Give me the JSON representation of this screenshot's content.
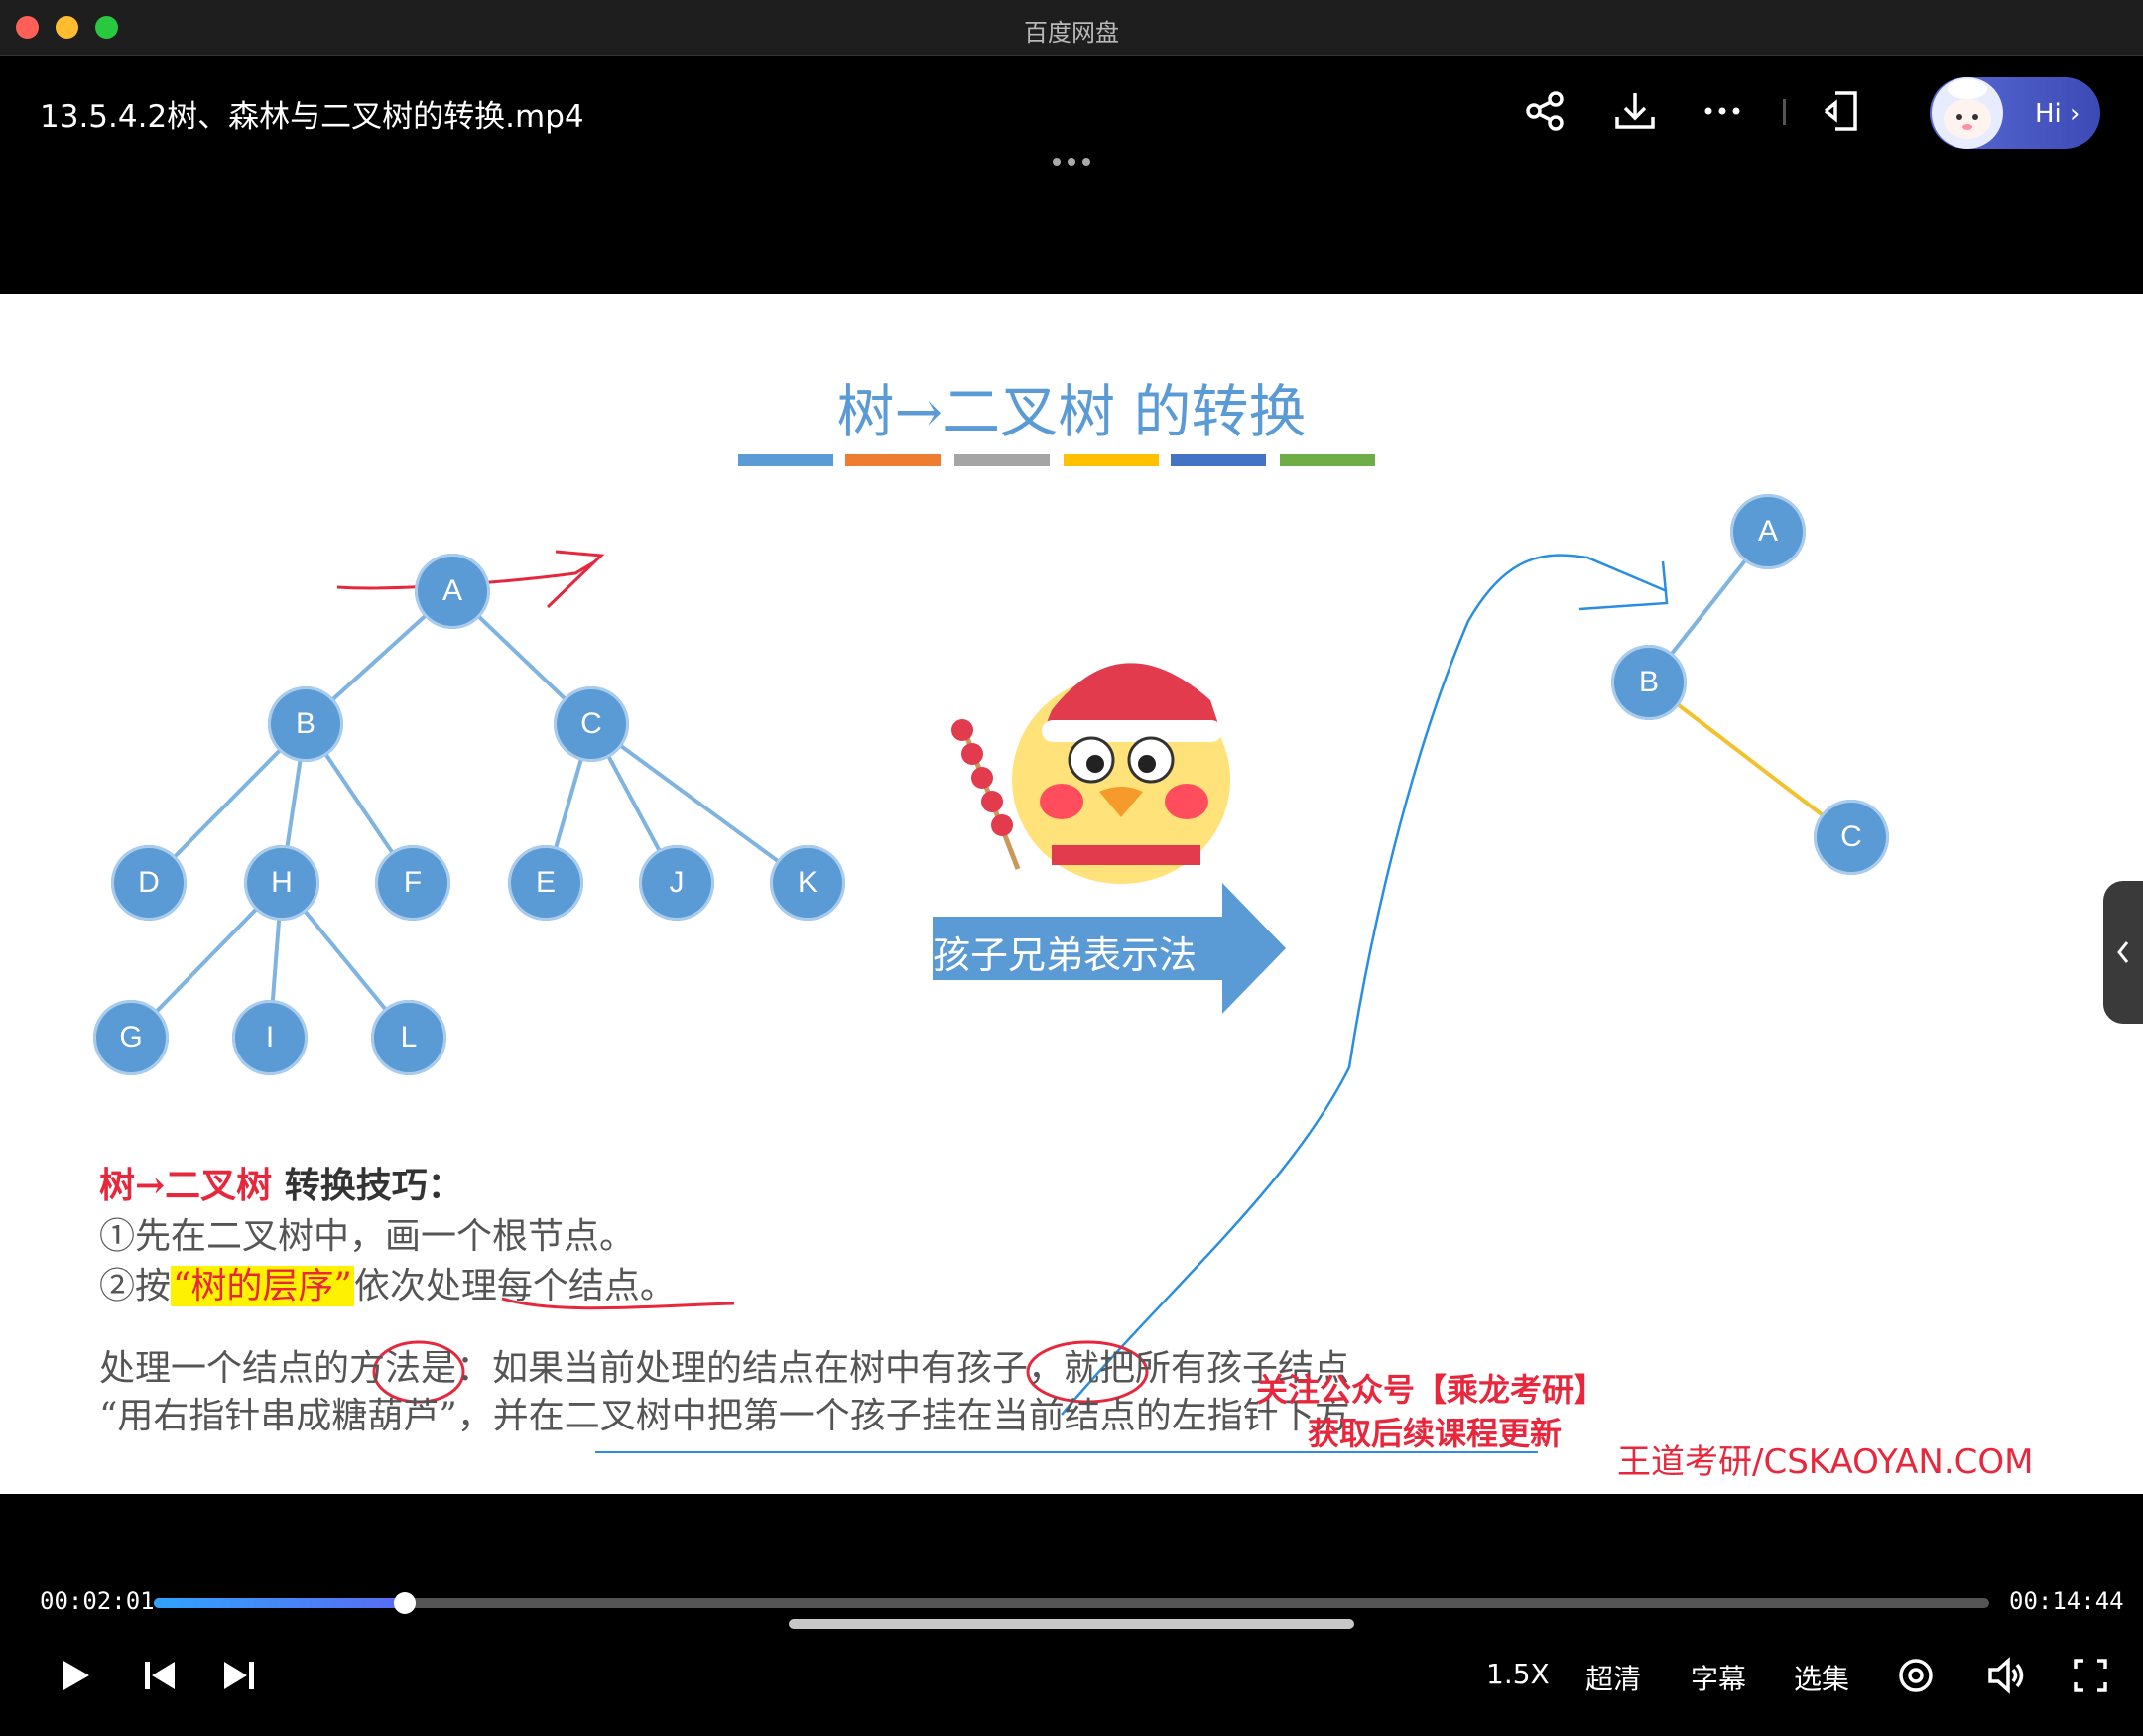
{
  "window": {
    "app_title": "百度网盘"
  },
  "header": {
    "video_title": "13.5.4.2树、森林与二叉树的转换.mp4",
    "assistant_label": "Hi",
    "icons": [
      "share-icon",
      "download-icon",
      "more-icon",
      "pip-icon"
    ]
  },
  "slide": {
    "title": "树→二叉树 的转换",
    "color_bar": [
      "#5b9bd5",
      "#ed7d31",
      "#a5a5a5",
      "#ffc000",
      "#4472c4",
      "#70ad47"
    ],
    "tree_nodes": [
      "A",
      "B",
      "C",
      "D",
      "H",
      "F",
      "E",
      "J",
      "K",
      "G",
      "I",
      "L"
    ],
    "binary_nodes": [
      "A",
      "B",
      "C"
    ],
    "arrow_label": "孩子兄弟表示法",
    "tips_heading_red": "树→二叉树",
    "tips_heading_rest": " 转换技巧：",
    "tip1": "①先在二叉树中，画一个根节点。",
    "tip2_prefix": "②按",
    "tip2_highlight": "“树的层序”",
    "tip2_suffix": "依次处理每个结点。",
    "para_line1": "处理一个结点的方法是：如果当前处理的结点在树中有孩子，就把所有孩子结点",
    "para_line2": "“用右指针串成糖葫芦”，并在二叉树中把第一个孩子挂在当前结点的左指针下方",
    "promo1": "关注公众号【乘龙考研】",
    "promo2": "获取后续课程更新",
    "watermark": "王道考研/CSKAOYAN.COM",
    "node_color": "#5b9bd5",
    "accent_red": "#e8273c"
  },
  "player": {
    "current_time": "00:02:01",
    "total_time": "00:14:44",
    "progress": 0.137,
    "speed": "1.5X",
    "quality": "超清",
    "subtitles": "字幕",
    "episodes": "选集"
  }
}
